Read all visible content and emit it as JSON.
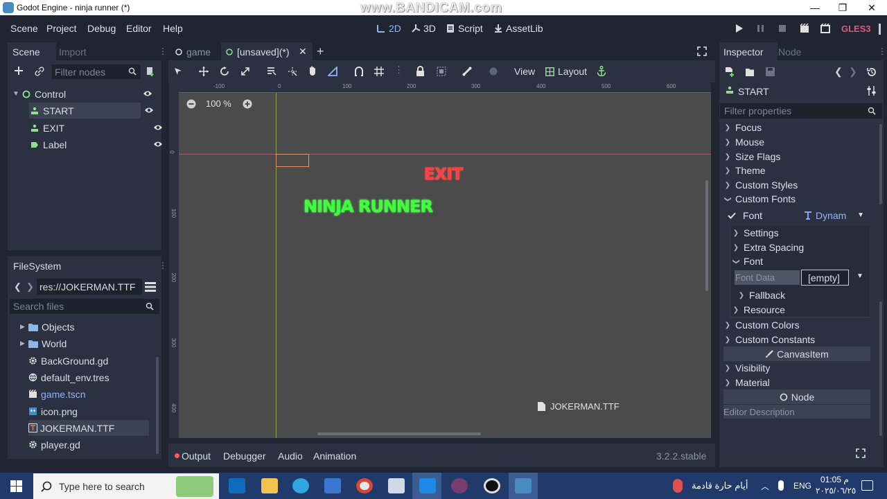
{
  "window": {
    "title": "Godot Engine - ninja runner (*)",
    "watermark": "www.BANDICAM.com",
    "controls": [
      "—",
      "❐",
      "✕"
    ]
  },
  "menubar": {
    "items": [
      "Scene",
      "Project",
      "Debug",
      "Editor",
      "Help"
    ],
    "workspaces": [
      "2D",
      "3D",
      "Script",
      "AssetLib"
    ],
    "renderer": "GLES3"
  },
  "scene_dock": {
    "tabs": [
      "Scene",
      "Import"
    ],
    "filter_placeholder": "Filter nodes",
    "nodes": [
      {
        "name": "Control"
      },
      {
        "name": "START"
      },
      {
        "name": "EXIT"
      },
      {
        "name": "Label"
      }
    ]
  },
  "filesystem": {
    "title": "FileSystem",
    "path": "res://JOKERMAN.TTF",
    "search_placeholder": "Search files",
    "items": [
      "Objects",
      "World",
      "BackGround.gd",
      "default_env.tres",
      "game.tscn",
      "icon.png",
      "JOKERMAN.TTF",
      "player.gd"
    ]
  },
  "editor_tabs": {
    "tabs": [
      "game",
      "[unsaved](*)"
    ]
  },
  "toolbar2d": {
    "view_label": "View",
    "layout_label": "Layout"
  },
  "viewport": {
    "zoom": "100 %",
    "ruler_top": [
      "-100",
      "0",
      "100",
      "200",
      "300",
      "400",
      "500",
      "600"
    ],
    "ruler_left": [
      "0",
      "100",
      "200",
      "300",
      "400"
    ],
    "exit_text": "EXIT",
    "ninja_text": "NINJA RUNNER",
    "drag_file": "JOKERMAN.TTF",
    "exit_color": "#ff4040",
    "ninja_color": "#3cff3c"
  },
  "bottom_panel": {
    "tabs": [
      "Output",
      "Debugger",
      "Audio",
      "Animation"
    ],
    "version": "3.2.2.stable"
  },
  "inspector": {
    "tabs": [
      "Inspector",
      "Node"
    ],
    "selected_node": "START",
    "filter_placeholder": "Filter properties",
    "sections_top": [
      "Focus",
      "Mouse",
      "Size Flags",
      "Theme",
      "Custom Styles",
      "Custom Fonts"
    ],
    "font_label": "Font",
    "font_value": "Dynam",
    "font_sub": [
      "Settings",
      "Extra Spacing",
      "Font"
    ],
    "font_data_label": "Font Data",
    "font_data_value": "[empty]",
    "font_sub2": [
      "Fallback",
      "Resource"
    ],
    "sections_bottom": [
      "Custom Colors",
      "Custom Constants"
    ],
    "canvas_item": "CanvasItem",
    "sections_ci": [
      "Visibility",
      "Material"
    ],
    "node_header": "Node",
    "editor_description": "Editor Description"
  },
  "taskbar": {
    "search_placeholder": "Type here to search",
    "weather": "أيام حارة قادمة",
    "lang": "ENG",
    "time": "01:05 م",
    "date": "٢٠٢٥/٠٦/٢٥"
  }
}
